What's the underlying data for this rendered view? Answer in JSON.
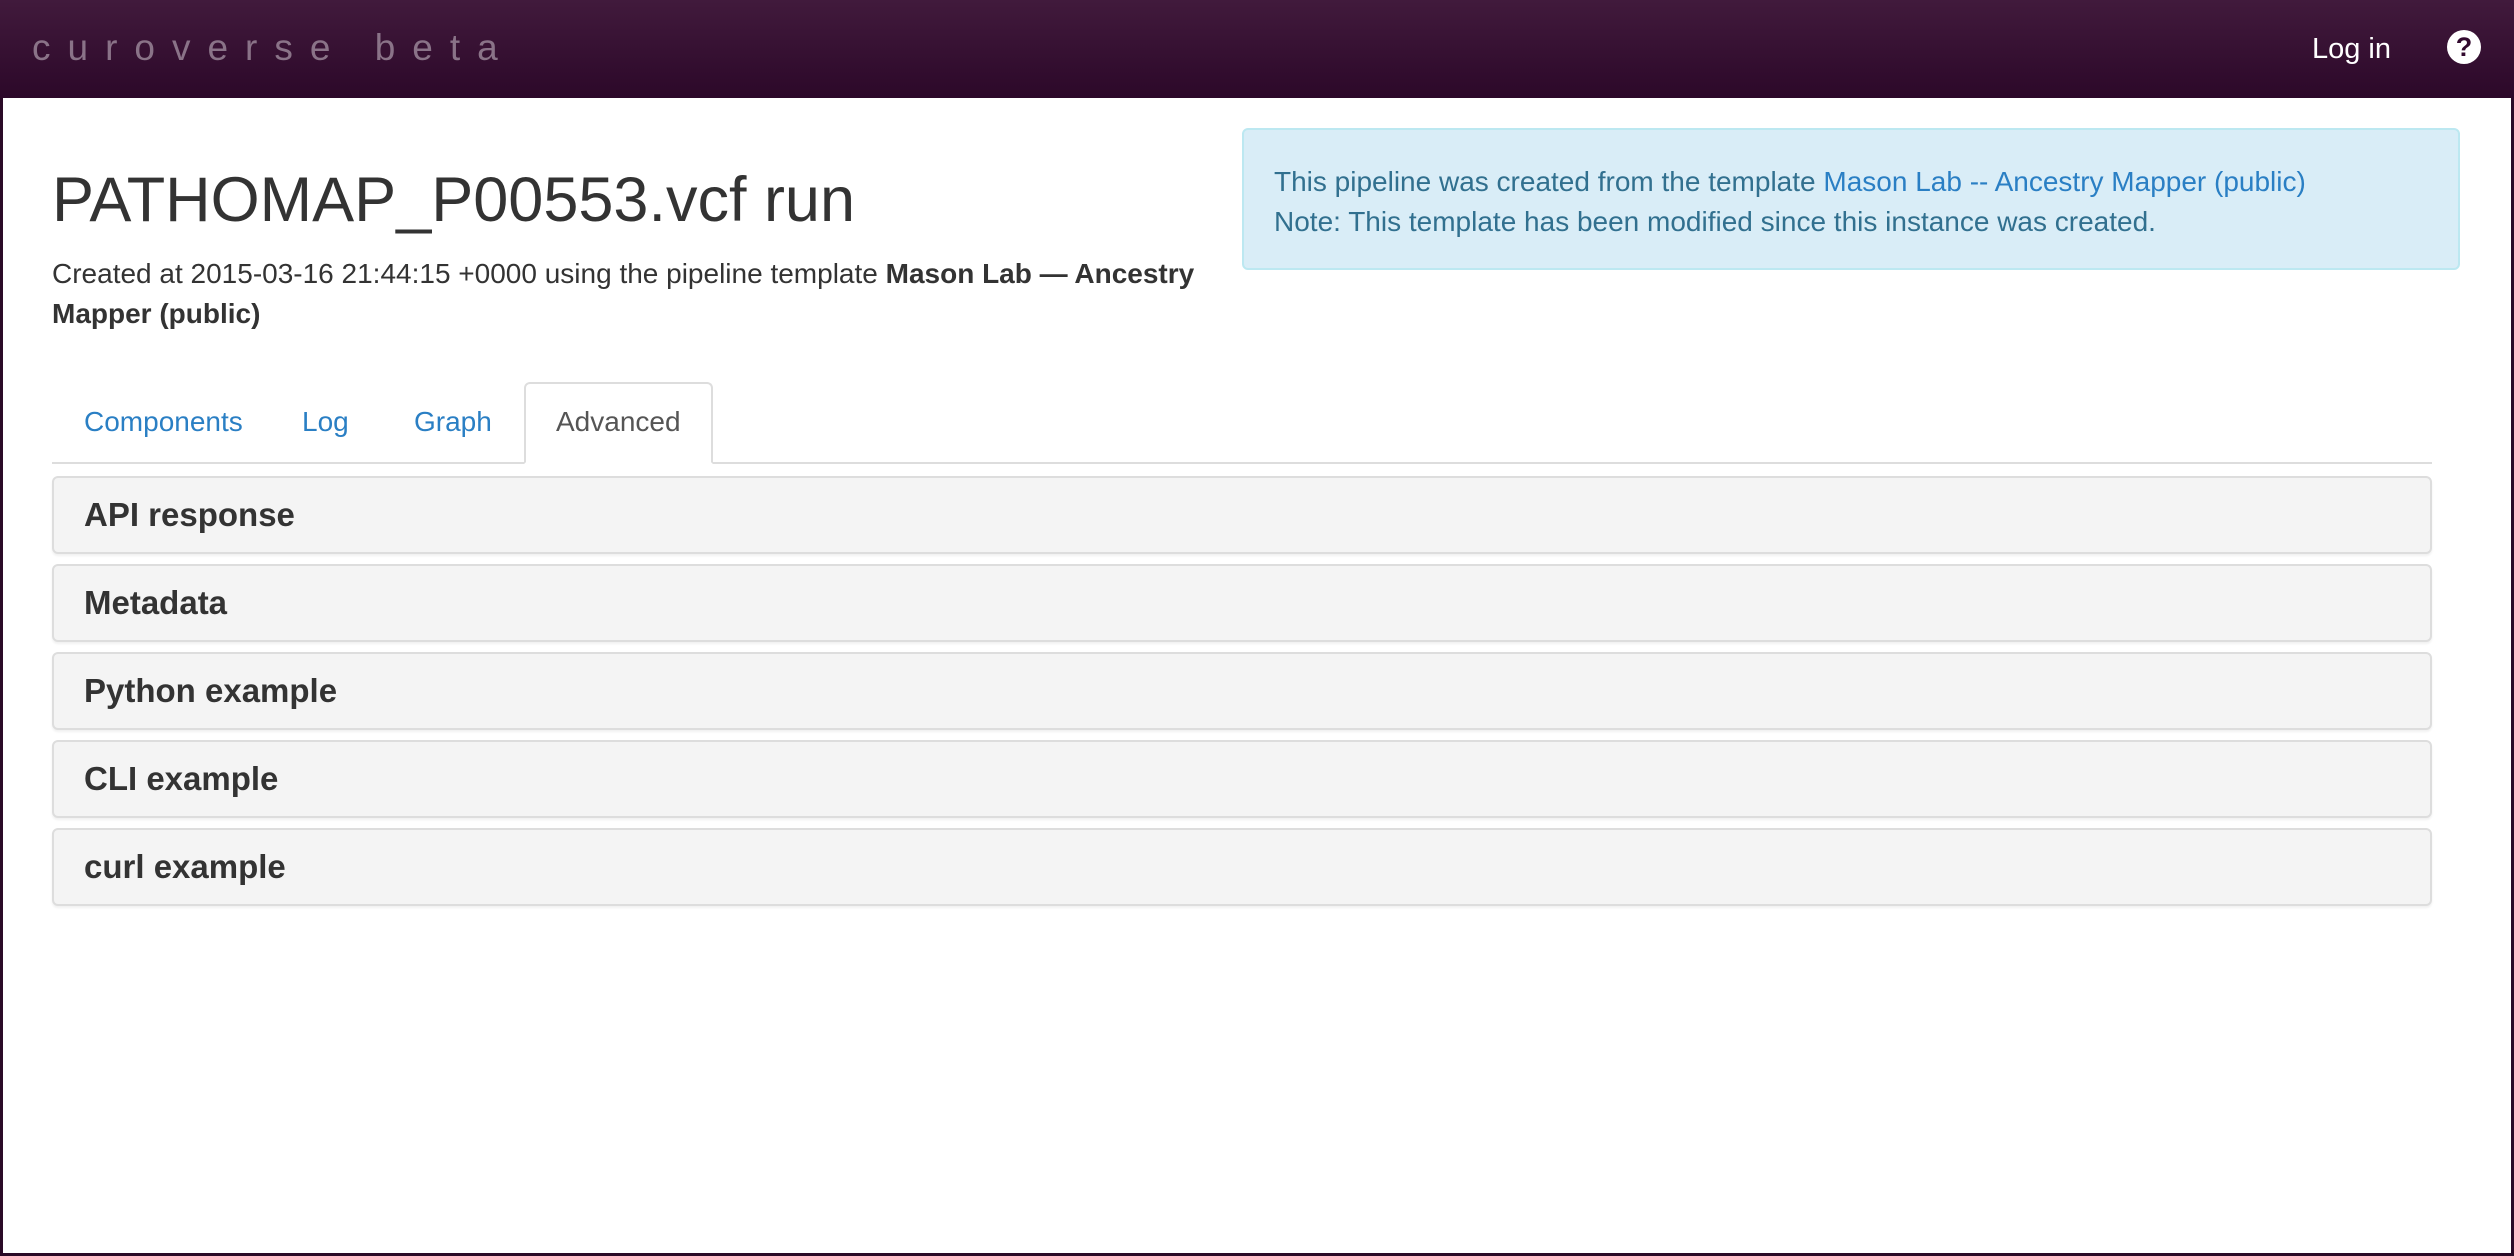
{
  "navbar": {
    "brand": "curoverse beta",
    "login_label": "Log in",
    "help_icon": "question-circle-icon",
    "help_glyph": "?"
  },
  "page": {
    "title": "PATHOMAP_P00553.vcf run",
    "created_prefix": "Created at 2015-03-16 21:44:15 +0000 using the pipeline template ",
    "template_name": "Mason Lab — Ancestry Mapper (public)"
  },
  "info": {
    "line1_prefix": "This pipeline was created from the template ",
    "template_link": "Mason Lab -- Ancestry Mapper (public)",
    "line2": "Note: This template has been modified since this instance was created."
  },
  "tabs": [
    {
      "label": "Components",
      "active": false
    },
    {
      "label": "Log",
      "active": false
    },
    {
      "label": "Graph",
      "active": false
    },
    {
      "label": "Advanced",
      "active": true
    }
  ],
  "panels": [
    {
      "label": "API response"
    },
    {
      "label": "Metadata"
    },
    {
      "label": "Python example"
    },
    {
      "label": "CLI example"
    },
    {
      "label": "curl example"
    }
  ],
  "colors": {
    "navbar_top": "#411a3c",
    "navbar_bottom": "#2c0829",
    "link": "#2a7fc4",
    "info_bg": "#d9edf7",
    "info_text": "#31708f"
  }
}
